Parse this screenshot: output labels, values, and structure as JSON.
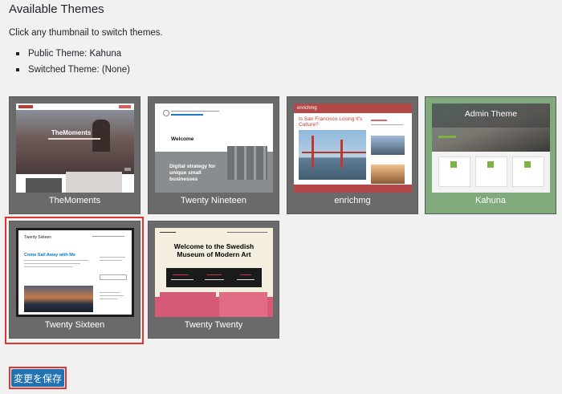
{
  "page": {
    "title": "Available Themes",
    "intro": "Click any thumbnail to switch themes.",
    "public_theme": "Public Theme: Kahuna",
    "switched_theme": "Switched Theme: (None)"
  },
  "themes": [
    {
      "name": "TheMoments",
      "preview_title": "TheMoments"
    },
    {
      "name": "Twenty Nineteen",
      "preview_welcome": "Welcome",
      "preview_tagline": "Digital strategy for unique small businesses"
    },
    {
      "name": "enrichmg",
      "preview_brand": "enrichmg",
      "preview_headline": "Is San Francisco Losing It's Culture?"
    },
    {
      "name": "Kahuna",
      "overlay": "Admin Theme"
    },
    {
      "name": "Twenty Sixteen",
      "preview_heading": "Come Sail Away with Me",
      "preview_site": "Twenty Sixteen"
    },
    {
      "name": "Twenty Twenty",
      "preview_heading": "Welcome to the Swedish Museum of Modern Art"
    }
  ],
  "save_button": "変更を保存",
  "colors": {
    "accent": "#2271b1",
    "highlight": "#e3342f",
    "admin_tile": "#80a97c"
  }
}
